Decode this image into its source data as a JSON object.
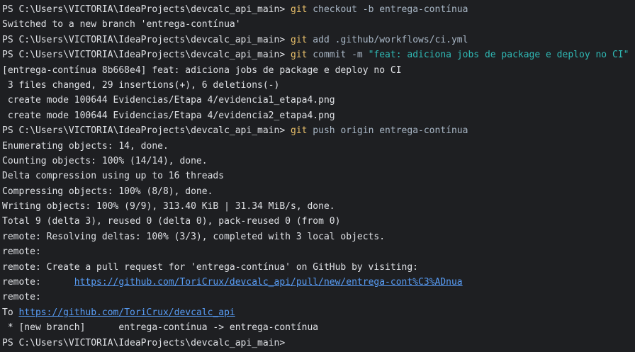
{
  "terminal": {
    "colors": {
      "background": "#1e1f22",
      "text": "#dfe1e5",
      "git_command": "#e8bf6a",
      "arguments": "#a9b7c6",
      "string_literal": "#2fb9b5",
      "link": "#589df6"
    },
    "prompt": "PS C:\\Users\\VICTORIA\\IdeaProjects\\devcalc_api_main> ",
    "cmd1": {
      "git": "git",
      "args": " checkout -b entrega-contínua"
    },
    "out1": "Switched to a new branch 'entrega-contínua'",
    "cmd2": {
      "git": "git",
      "args": " add .github/workflows/ci.yml"
    },
    "cmd3": {
      "git": "git",
      "args": " commit -m ",
      "message": "\"feat: adiciona jobs de package e deploy no CI\""
    },
    "out3": [
      "[entrega-contínua 8b668e4] feat: adiciona jobs de package e deploy no CI",
      " 3 files changed, 29 insertions(+), 6 deletions(-)",
      " create mode 100644 Evidencias/Etapa 4/evidencia1_etapa4.png",
      " create mode 100644 Evidencias/Etapa 4/evidencia2_etapa4.png"
    ],
    "cmd4": {
      "git": "git",
      "args": " push origin entrega-contínua"
    },
    "out4": [
      "Enumerating objects: 14, done.",
      "Counting objects: 100% (14/14), done.",
      "Delta compression using up to 16 threads",
      "Compressing objects: 100% (8/8), done.",
      "Writing objects: 100% (9/9), 313.40 KiB | 31.34 MiB/s, done.",
      "Total 9 (delta 3), reused 0 (delta 0), pack-reused 0 (from 0)",
      "remote: Resolving deltas: 100% (3/3), completed with 3 local objects.",
      "remote:",
      "remote: Create a pull request for 'entrega-contínua' on GitHub by visiting:"
    ],
    "remote_prefix": "remote:      ",
    "pr_url": "https://github.com/ToriCrux/devcalc_api/pull/new/entrega-cont%C3%ADnua",
    "remote_blank": "remote:",
    "to_prefix": "To ",
    "repo_url": "https://github.com/ToriCrux/devcalc_api",
    "branch_line": " * [new branch]      entrega-contínua -> entrega-contínua"
  }
}
